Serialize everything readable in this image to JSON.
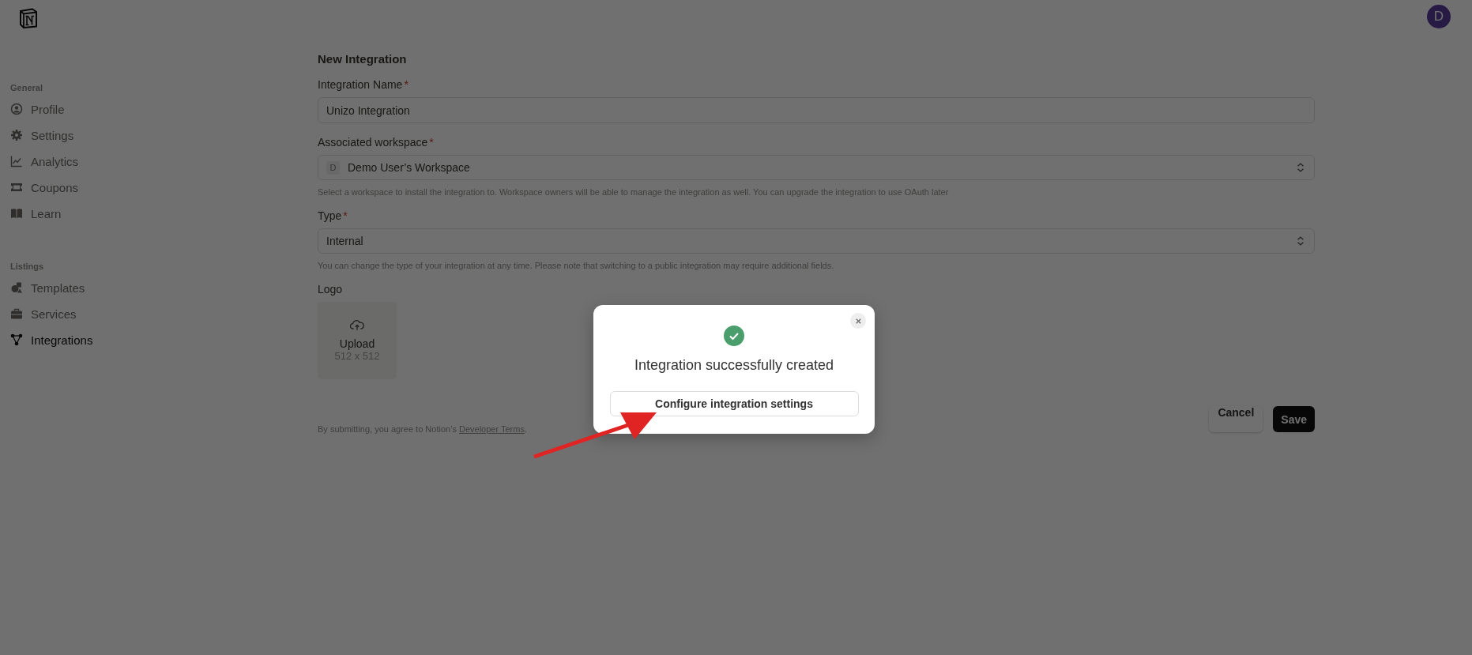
{
  "avatar": {
    "initial": "D"
  },
  "sidebar": {
    "sections": [
      {
        "heading": "General",
        "items": [
          {
            "label": "Profile",
            "selected": false
          },
          {
            "label": "Settings",
            "selected": false
          },
          {
            "label": "Analytics",
            "selected": false
          },
          {
            "label": "Coupons",
            "selected": false
          },
          {
            "label": "Learn",
            "selected": false
          }
        ]
      },
      {
        "heading": "Listings",
        "items": [
          {
            "label": "Templates",
            "selected": false
          },
          {
            "label": "Services",
            "selected": false
          },
          {
            "label": "Integrations",
            "selected": true
          }
        ]
      }
    ]
  },
  "form": {
    "title": "New Integration",
    "fields": [
      {
        "kind": "text",
        "label": "Integration Name",
        "required_mark": "*",
        "value": "Unizo Integration"
      },
      {
        "kind": "select",
        "label": "Associated workspace",
        "required_mark": "*",
        "badge": "D",
        "value": "Demo User’s Workspace",
        "help": "Select a workspace to install the integration to. Workspace owners will be able to manage the integration as well. You can upgrade the integration to use OAuth later"
      },
      {
        "kind": "select",
        "label": "Type",
        "required_mark": "*",
        "value": "Internal",
        "help": "You can change the type of your integration at any time. Please note that switching to a public integration may require additional fields."
      },
      {
        "kind": "upload",
        "label": "Logo",
        "action": "Upload",
        "size": "512 x 512"
      }
    ],
    "terms": {
      "text": "By submitting, you agree to Notion’s ",
      "link": "Developer Terms",
      "end": "."
    },
    "buttons": [
      {
        "kind": "secondary",
        "label": "Cancel"
      },
      {
        "kind": "primary",
        "label": "Save"
      }
    ]
  },
  "dialog": {
    "title": "Integration successfully created",
    "button": "Configure integration settings"
  }
}
